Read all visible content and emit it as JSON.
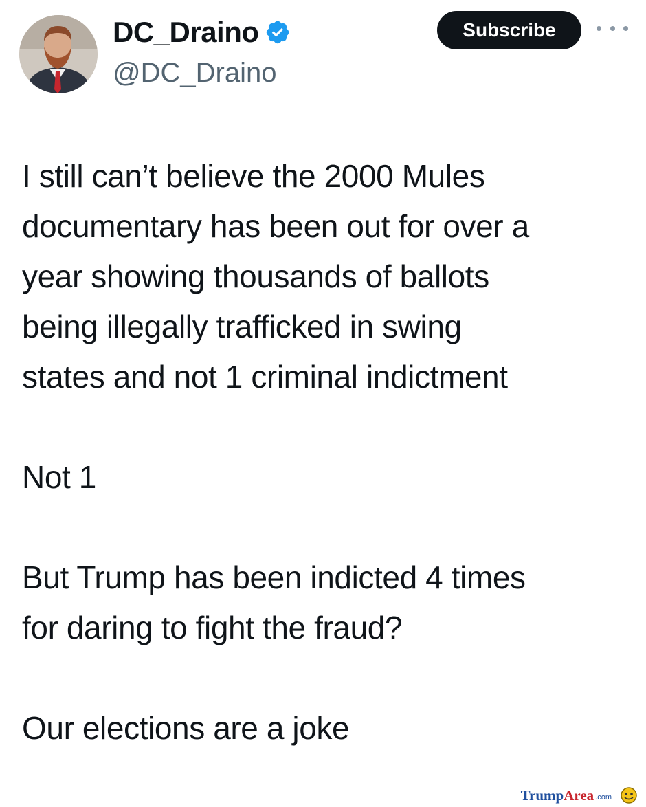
{
  "profile": {
    "display_name": "DC_Draino",
    "handle": "@DC_Draino",
    "verified": true,
    "avatar_icon": "profile-photo"
  },
  "actions": {
    "subscribe_label": "Subscribe",
    "more_icon": "more-options-icon"
  },
  "tweet": {
    "paragraphs": [
      "I still can’t believe the 2000 Mules\ndocumentary has been out for over a\nyear showing thousands of ballots\nbeing illegally trafficked in swing\nstates and not 1 criminal indictment",
      "Not 1",
      "But Trump has been indicted 4 times\nfor daring to fight the fraud?",
      "Our elections are a joke"
    ]
  },
  "watermark": {
    "brand_part1": "Trump",
    "brand_part2": "Area",
    "suffix": ".com"
  },
  "colors": {
    "text": "#0f1419",
    "handle": "#536471",
    "button_bg": "#0f1419",
    "verified_badge": "#1d9bf0",
    "watermark_blue": "#1f4f9e",
    "watermark_red": "#c8262e"
  }
}
